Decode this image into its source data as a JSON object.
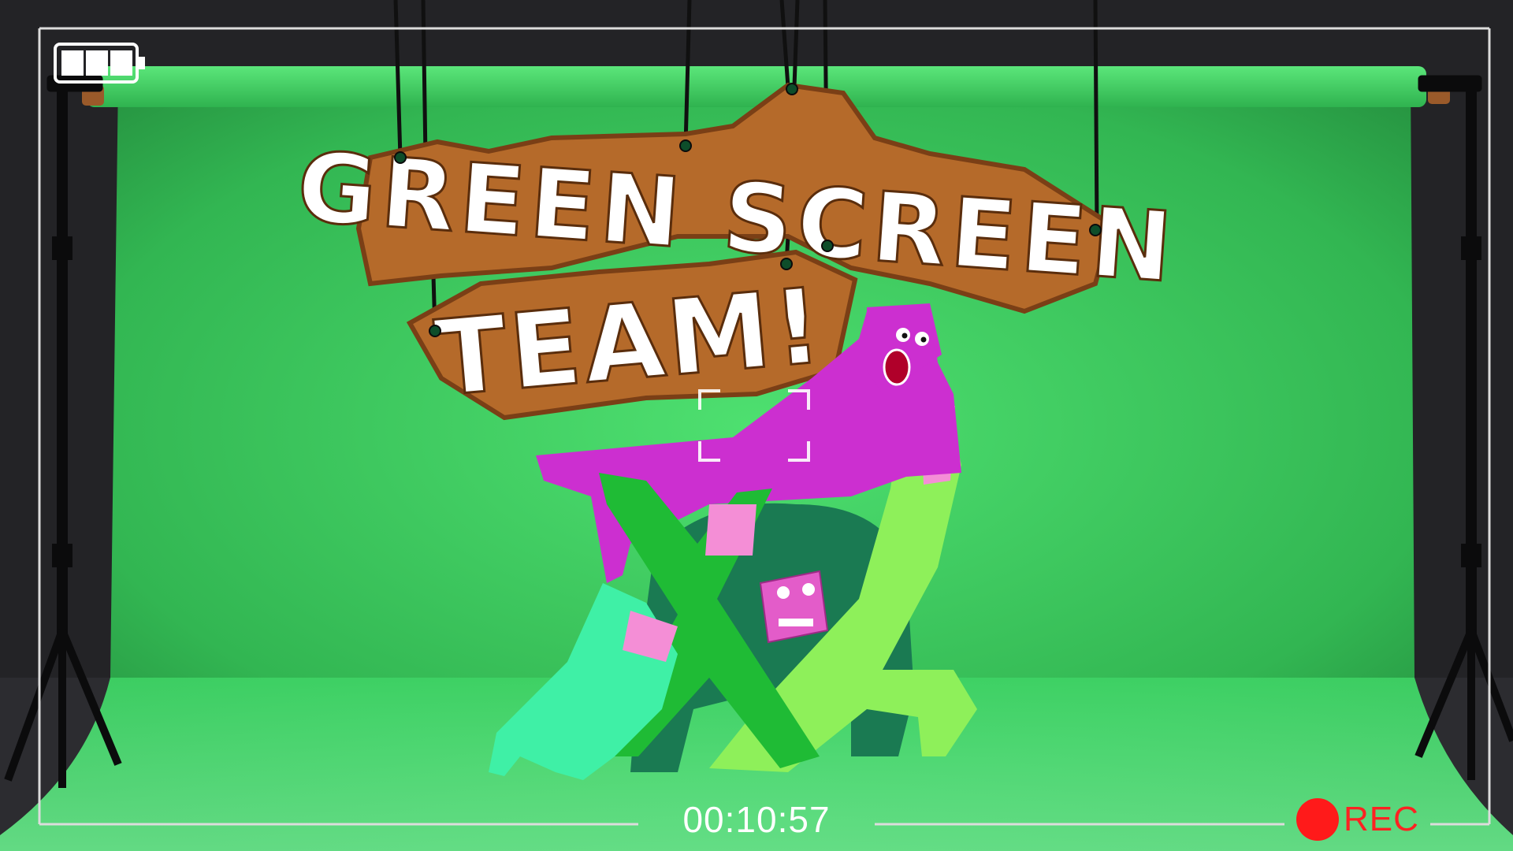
{
  "hud": {
    "timecode": "00:10:57",
    "rec_label": "REC",
    "battery_level": 1.0,
    "rec_color": "#ff1a1a"
  },
  "title_sign": {
    "line1": "GREEN SCREEN",
    "line2": "TEAM!"
  },
  "icons": [
    "battery-icon",
    "record-dot-icon",
    "focus-brackets-icon"
  ],
  "colors": {
    "backdrop": "#34c45a",
    "backdrop_light": "#4ee070",
    "cardboard": "#b56a2a",
    "chalk": "#ffffff",
    "magenta": "#cc2fd0",
    "pink": "#f48ed6",
    "lime": "#8ef05a",
    "green": "#1fbb35",
    "teal": "#3ff0a6",
    "dark_green": "#1a7a52"
  }
}
